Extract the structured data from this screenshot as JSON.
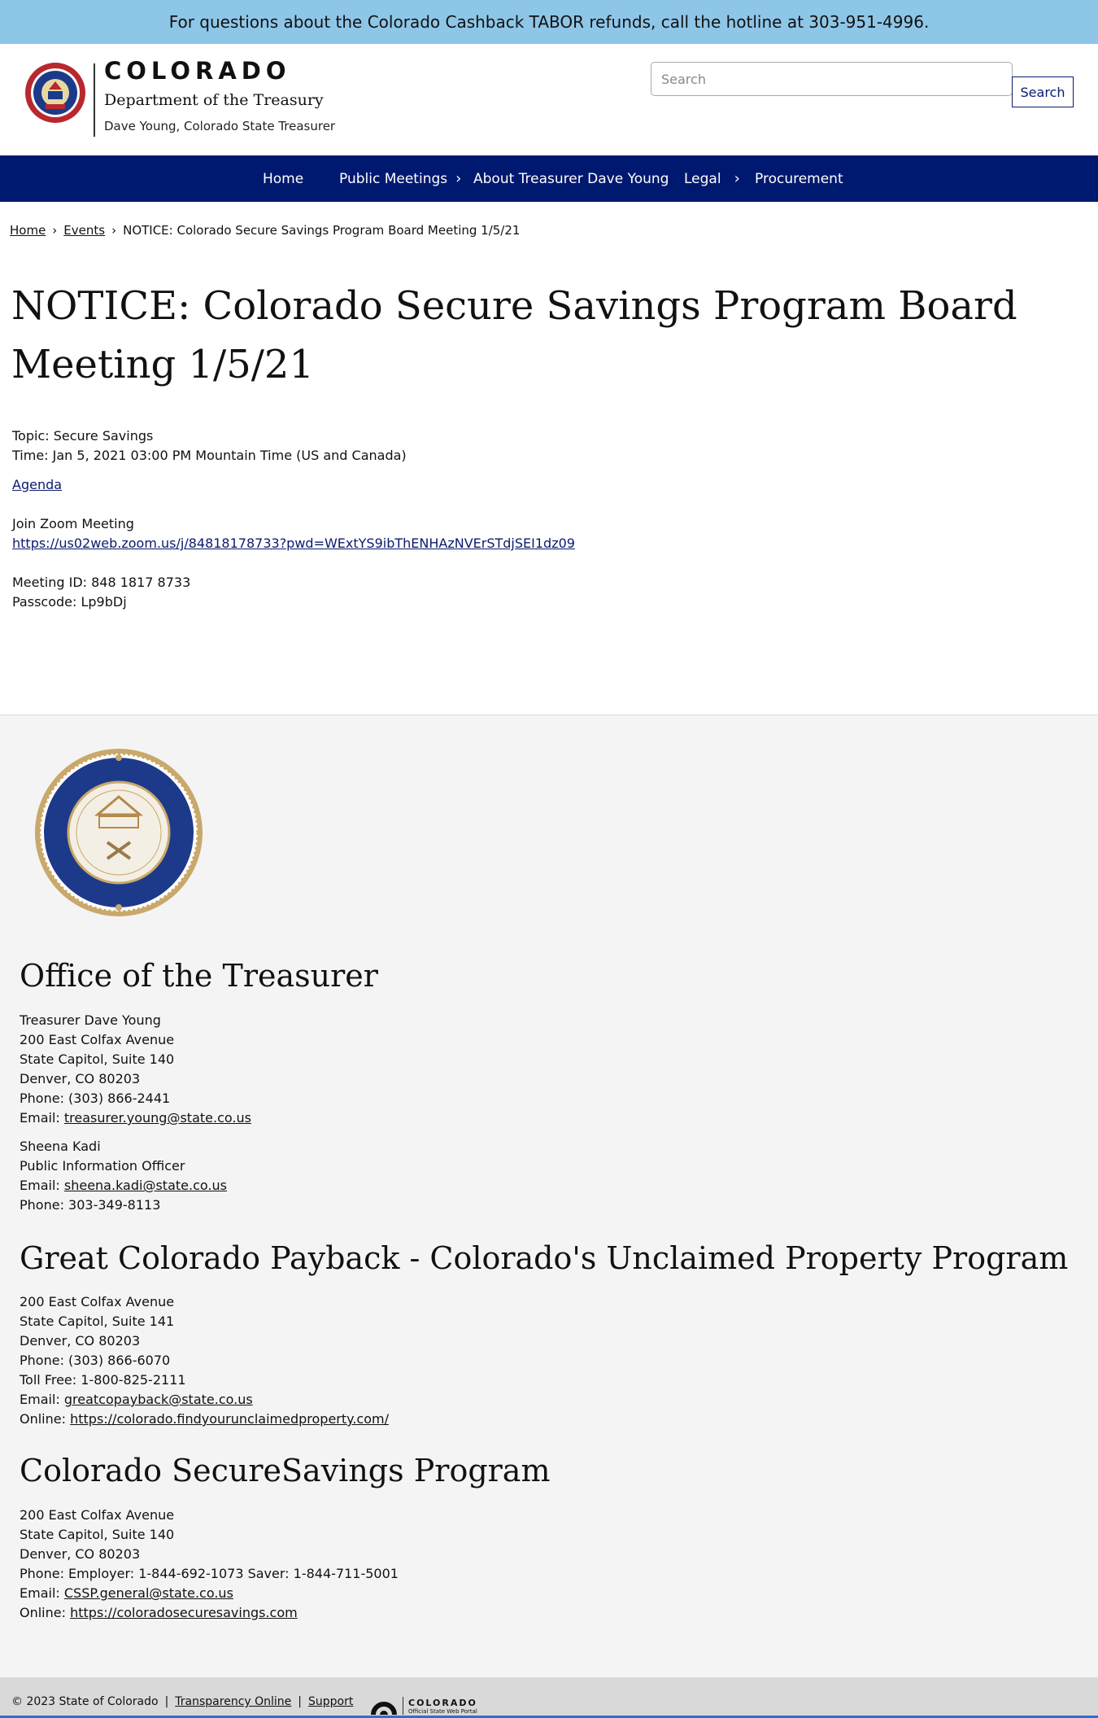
{
  "alert": {
    "text": "For questions about the Colorado Cashback TABOR refunds, call the hotline at 303-951-4996."
  },
  "header": {
    "brand_title": "COLORADO",
    "brand_dept": "Department of the Treasury",
    "brand_sub": "Dave Young, Colorado State Treasurer",
    "search_placeholder": "Search",
    "search_button": "Search"
  },
  "nav": {
    "items": [
      {
        "label": "Home"
      },
      {
        "label": "Public Meetings"
      },
      {
        "label": "About Treasurer Dave Young"
      },
      {
        "label": "Legal"
      },
      {
        "label": "Procurement"
      }
    ],
    "chevron": "›"
  },
  "breadcrumb": {
    "items": [
      "Home",
      "Events",
      "NOTICE: Colorado Secure Savings Program Board Meeting 1/5/21"
    ],
    "separator": "›"
  },
  "page": {
    "title": "NOTICE: Colorado Secure Savings Program Board Meeting 1/5/21",
    "topic": "Topic: Secure Savings",
    "time": "Time: Jan 5, 2021 03:00 PM Mountain Time (US and Canada)",
    "agenda_link": "Agenda",
    "join_label": "Join Zoom Meeting",
    "zoom_link": "https://us02web.zoom.us/j/84818178733?pwd=WExtYS9ibThENHAzNVErSTdjSEI1dz09",
    "meeting_id": "Meeting ID: 848 1817 8733",
    "passcode": "Passcode: Lp9bDj"
  },
  "footer": {
    "office": {
      "heading": "Office of the Treasurer",
      "lines": [
        "Treasurer Dave Young",
        "200 East Colfax Avenue",
        "State Capitol, Suite 140",
        "Denver, CO 80203",
        "Phone: (303) 866-2441"
      ],
      "email_label": "Email: ",
      "email": "treasurer.young@state.co.us",
      "pio_lines": [
        "Sheena Kadi",
        "Public Information Officer"
      ],
      "pio_email_label": "Email: ",
      "pio_email": "sheena.kadi@state.co.us",
      "pio_phone": "Phone: 303-349-8113"
    },
    "payback": {
      "heading": "Great Colorado Payback - Colorado's Unclaimed Property Program",
      "lines": [
        "200 East Colfax Avenue",
        "State Capitol, Suite 141",
        "Denver, CO 80203",
        "Phone: (303) 866-6070",
        "Toll Free:  1-800-825-2111"
      ],
      "email_label": "Email: ",
      "email": "greatcopayback@state.co.us",
      "online_label": "Online: ",
      "online": "https://colorado.findyourunclaimedproperty.com/"
    },
    "securesavings": {
      "heading": "Colorado SecureSavings Program",
      "lines": [
        "200 East Colfax Avenue",
        "State Capitol, Suite 140",
        "Denver, CO 80203",
        "Phone: Employer: 1-844-692-1073  Saver: 1-844-711-5001"
      ],
      "email_label": "Email: ",
      "email": "CSSP.general@state.co.us",
      "online_label": "Online: ",
      "online": "https://coloradosecuresavings.com"
    }
  },
  "bottombar": {
    "copyright": "© 2023 State of Colorado",
    "sep": "|",
    "transparency": "Transparency Online",
    "support": "Support",
    "portal_title": "COLORADO",
    "portal_sub": "Official State Web Portal"
  },
  "colors": {
    "alert": "#8ec6e8",
    "nav": "#001970",
    "accent": "#0a1a6e",
    "footer_bg": "#f4f4f4"
  }
}
